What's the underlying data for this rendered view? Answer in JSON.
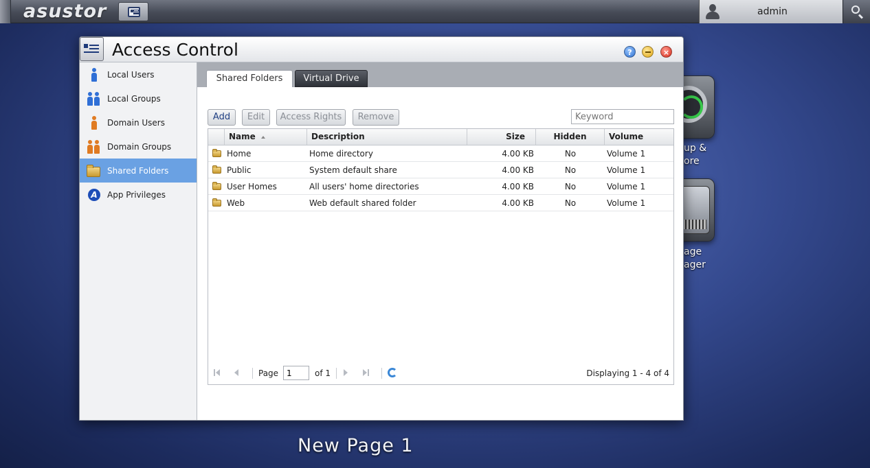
{
  "topbar": {
    "brand": "asustor",
    "user": "admin"
  },
  "desktop": {
    "backup_label_1": "up &",
    "backup_label_2": "ore",
    "storage_label_1": "age",
    "storage_label_2": "ager",
    "page_name": "New Page 1"
  },
  "window": {
    "title": "Access Control",
    "help_label": "?",
    "close_label": "×"
  },
  "sidebar": {
    "items": [
      {
        "label": "Local Users"
      },
      {
        "label": "Local Groups"
      },
      {
        "label": "Domain Users"
      },
      {
        "label": "Domain Groups"
      },
      {
        "label": "Shared Folders"
      },
      {
        "label": "App Privileges"
      }
    ],
    "active": "Shared Folders",
    "app_badge": "A"
  },
  "tabs": [
    {
      "label": "Shared Folders"
    },
    {
      "label": "Virtual Drive"
    }
  ],
  "toolbar": {
    "add": "Add",
    "edit": "Edit",
    "access_rights": "Access Rights",
    "remove": "Remove",
    "keyword_placeholder": "Keyword"
  },
  "table": {
    "columns": [
      "Name",
      "Description",
      "Size",
      "Hidden",
      "Volume"
    ],
    "rows": [
      {
        "name": "Home",
        "description": "Home directory",
        "size": "4.00 KB",
        "hidden": "No",
        "volume": "Volume 1"
      },
      {
        "name": "Public",
        "description": "System default share",
        "size": "4.00 KB",
        "hidden": "No",
        "volume": "Volume 1"
      },
      {
        "name": "User Homes",
        "description": "All users' home directories",
        "size": "4.00 KB",
        "hidden": "No",
        "volume": "Volume 1"
      },
      {
        "name": "Web",
        "description": "Web default shared folder",
        "size": "4.00 KB",
        "hidden": "No",
        "volume": "Volume 1"
      }
    ]
  },
  "pager": {
    "page_label": "Page",
    "page_value": "1",
    "of_label": "of 1",
    "displaying": "Displaying 1 - 4 of 4"
  },
  "colors": {
    "sidebar_active": "#6aa1e3",
    "accent_blue": "#2f6fd6",
    "accent_orange": "#e07b22"
  }
}
